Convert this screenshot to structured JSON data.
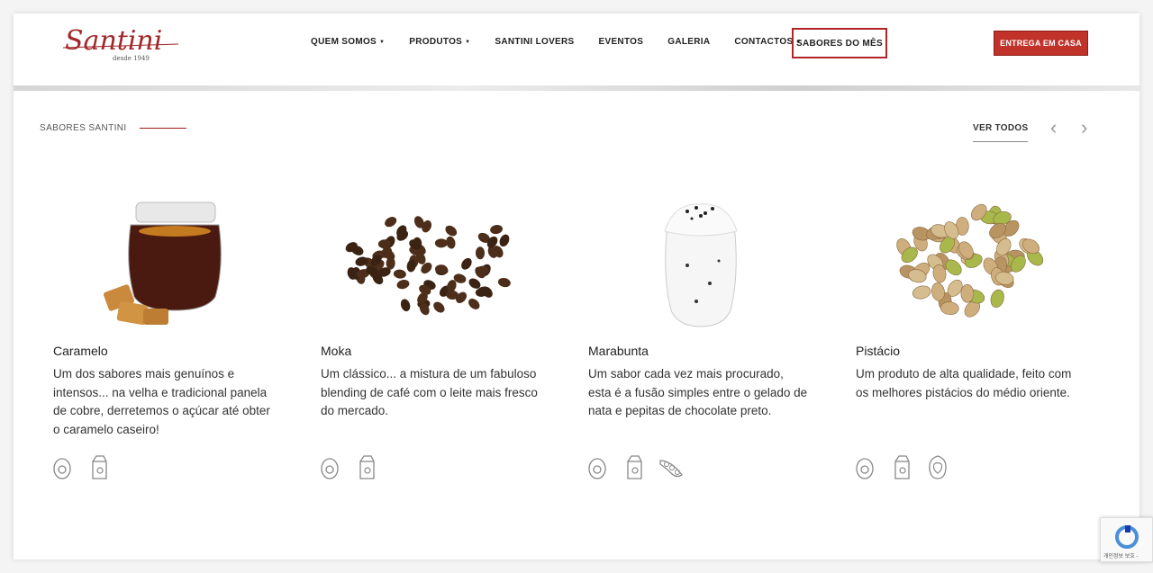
{
  "brand": {
    "logo_text": "Santini",
    "logo_tagline": "desde 1949"
  },
  "nav": {
    "items": [
      {
        "label": "QUEM SOMOS",
        "dropdown": true
      },
      {
        "label": "PRODUTOS",
        "dropdown": true
      },
      {
        "label": "SANTINI LOVERS",
        "dropdown": false
      },
      {
        "label": "EVENTOS",
        "dropdown": false
      },
      {
        "label": "GALERIA",
        "dropdown": false
      },
      {
        "label": "CONTACTOS",
        "dropdown": true
      }
    ],
    "highlight_label": "SABORES DO MÊS",
    "cta_label": "ENTREGA EM CASA"
  },
  "section": {
    "label": "SABORES SANTINI",
    "see_all": "VER TODOS"
  },
  "flavors": [
    {
      "name": "Caramelo",
      "description": "Um dos sabores mais genuínos e intensos... na velha e tradicional panela de cobre, derretemos o açúcar até obter o caramelo caseiro!",
      "image": "caramel-jar-image",
      "icons": [
        "egg-icon",
        "milk-carton-icon"
      ]
    },
    {
      "name": "Moka",
      "description": "Um clássico... a mistura de um fabuloso blending de café com o leite mais fresco do mercado.",
      "image": "coffee-beans-image",
      "icons": [
        "egg-icon",
        "milk-carton-icon"
      ]
    },
    {
      "name": "Marabunta",
      "description": "Um sabor cada vez mais procurado, esta é a fusão simples entre o gelado de nata e pepitas de chocolate preto.",
      "image": "cream-jar-image",
      "icons": [
        "egg-icon",
        "milk-carton-icon",
        "soy-icon"
      ]
    },
    {
      "name": "Pistácio",
      "description": "Um produto de alta qualidade, feito com os melhores pistácios do médio oriente.",
      "image": "pistachio-image",
      "icons": [
        "egg-icon",
        "milk-carton-icon",
        "nut-icon"
      ]
    }
  ],
  "recaptcha": {
    "text": "개인정보 보호 -"
  },
  "colors": {
    "brand_red": "#c0322a",
    "accent_line": "#9b1c1c"
  }
}
